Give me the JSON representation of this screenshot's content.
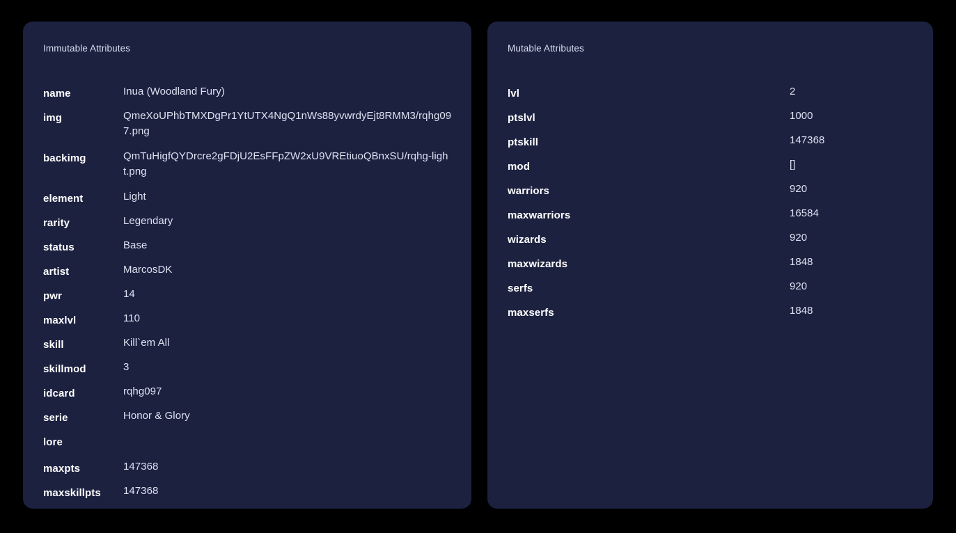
{
  "page": {
    "background_color": "#000000",
    "card_color": "#1c2140",
    "label_color": "#ffffff",
    "value_color": "#dde1f0",
    "header_color": "#d9def0"
  },
  "immutable": {
    "header": "Immutable Attributes",
    "rows": [
      {
        "label": "name",
        "value": "Inua (Woodland Fury)"
      },
      {
        "label": "img",
        "value": "QmeXoUPhbTMXDgPr1YtUTX4NgQ1nWs88yvwrdyEjt8RMM3/rqhg097.png"
      },
      {
        "label": "backimg",
        "value": "QmTuHigfQYDrcre2gFDjU2EsFFpZW2xU9VREtiuoQBnxSU/rqhg-light.png"
      },
      {
        "label": "element",
        "value": "Light"
      },
      {
        "label": "rarity",
        "value": "Legendary"
      },
      {
        "label": "status",
        "value": "Base"
      },
      {
        "label": "artist",
        "value": "MarcosDK"
      },
      {
        "label": "pwr",
        "value": "14"
      },
      {
        "label": "maxlvl",
        "value": "110"
      },
      {
        "label": "skill",
        "value": "Kill`em All"
      },
      {
        "label": "skillmod",
        "value": "3"
      },
      {
        "label": "idcard",
        "value": "rqhg097"
      },
      {
        "label": "serie",
        "value": "Honor & Glory"
      },
      {
        "label": "lore",
        "value": ""
      },
      {
        "label": "maxpts",
        "value": "147368"
      },
      {
        "label": "maxskillpts",
        "value": "147368"
      }
    ]
  },
  "mutable": {
    "header": "Mutable Attributes",
    "rows": [
      {
        "label": "lvl",
        "value": "2"
      },
      {
        "label": "ptslvl",
        "value": "1000"
      },
      {
        "label": "ptskill",
        "value": "147368"
      },
      {
        "label": "mod",
        "value": "[]"
      },
      {
        "label": "warriors",
        "value": "920"
      },
      {
        "label": "maxwarriors",
        "value": "16584"
      },
      {
        "label": "wizards",
        "value": "920"
      },
      {
        "label": "maxwizards",
        "value": "1848"
      },
      {
        "label": "serfs",
        "value": "920"
      },
      {
        "label": "maxserfs",
        "value": "1848"
      }
    ]
  }
}
